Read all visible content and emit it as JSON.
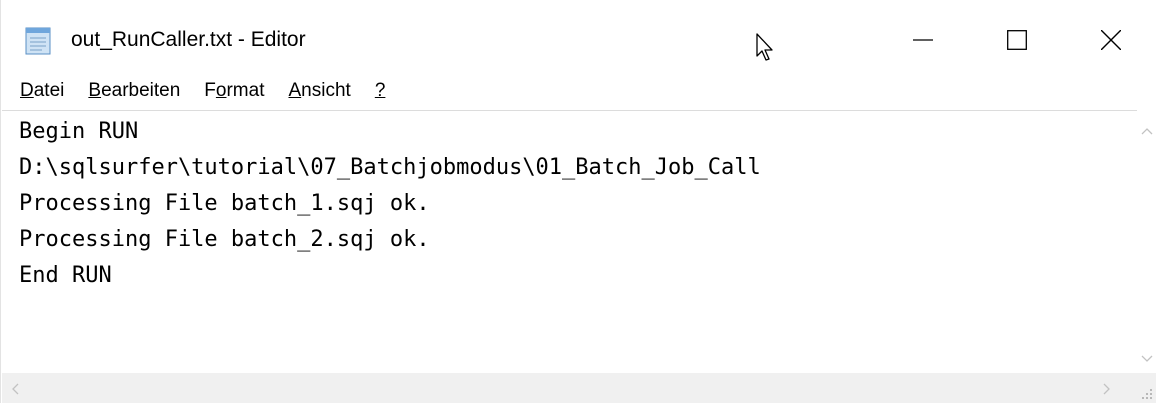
{
  "window": {
    "title": "out_RunCaller.txt - Editor",
    "app_icon": "notepad-icon",
    "controls": {
      "minimize": "minimize-icon",
      "maximize": "maximize-icon",
      "close": "close-icon"
    }
  },
  "menu": {
    "items": [
      {
        "label_ul": "D",
        "label_rest": "atei",
        "label_pre": ""
      },
      {
        "label_ul": "B",
        "label_rest": "earbeiten",
        "label_pre": ""
      },
      {
        "label_pre": "F",
        "label_ul": "o",
        "label_rest": "rmat"
      },
      {
        "label_ul": "A",
        "label_rest": "nsicht",
        "label_pre": ""
      },
      {
        "label_ul": "?",
        "label_rest": "",
        "label_pre": ""
      }
    ]
  },
  "editor": {
    "lines": [
      "Begin RUN",
      "D:\\sqlsurfer\\tutorial\\07_Batchjobmodus\\01_Batch_Job_Call",
      "Processing File batch_1.sqj ok.",
      "Processing File batch_2.sqj ok.",
      "End RUN"
    ]
  },
  "colors": {
    "background": "#ffffff",
    "scrollbar_bg": "#f0f0f0",
    "text": "#000000"
  }
}
